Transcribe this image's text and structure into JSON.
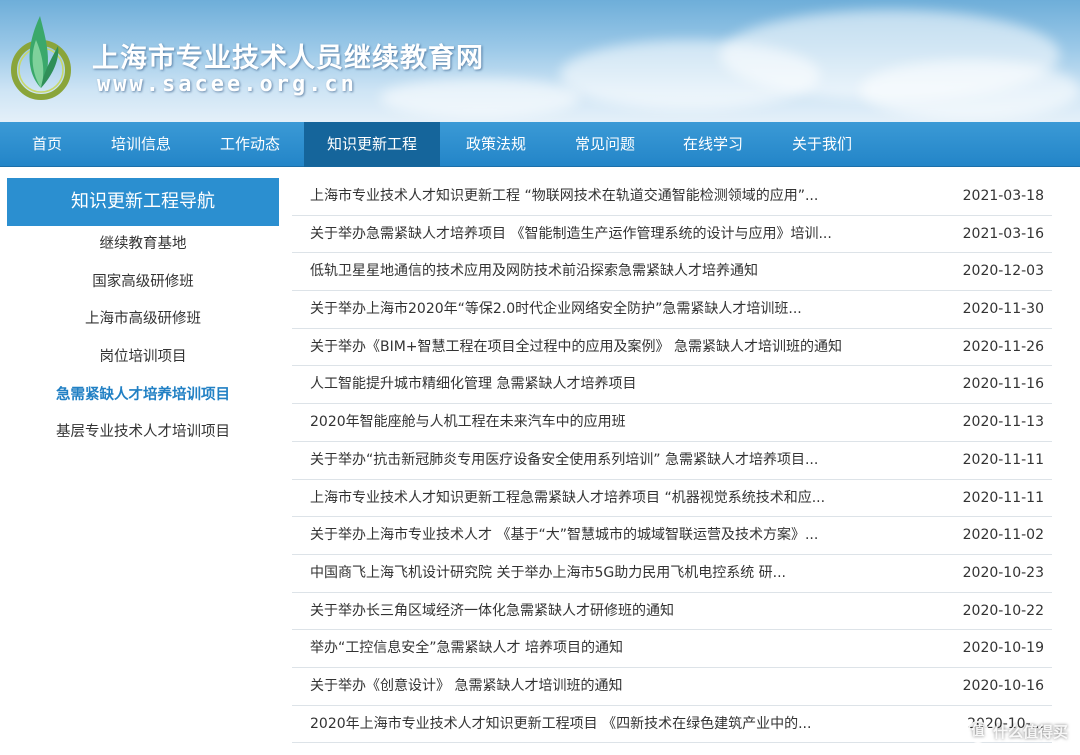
{
  "header": {
    "site_title": "上海市专业技术人员继续教育网",
    "site_url": "www.sacee.org.cn"
  },
  "nav": {
    "items": [
      {
        "label": "首页"
      },
      {
        "label": "培训信息"
      },
      {
        "label": "工作动态"
      },
      {
        "label": "知识更新工程",
        "active": true
      },
      {
        "label": "政策法规"
      },
      {
        "label": "常见问题"
      },
      {
        "label": "在线学习"
      },
      {
        "label": "关于我们"
      }
    ]
  },
  "sidebar": {
    "title": "知识更新工程导航",
    "items": [
      {
        "label": "继续教育基地"
      },
      {
        "label": "国家高级研修班"
      },
      {
        "label": "上海市高级研修班"
      },
      {
        "label": "岗位培训项目"
      },
      {
        "label": "急需紧缺人才培养培训项目",
        "active": true
      },
      {
        "label": "基层专业技术人才培训项目"
      }
    ]
  },
  "news": [
    {
      "title": "上海市专业技术人才知识更新工程 “物联网技术在轨道交通智能检测领域的应用”...",
      "date": "2021-03-18"
    },
    {
      "title": "关于举办急需紧缺人才培养项目 《智能制造生产运作管理系统的设计与应用》培训...",
      "date": "2021-03-16"
    },
    {
      "title": "低轨卫星星地通信的技术应用及网防技术前沿探索急需紧缺人才培养通知",
      "date": "2020-12-03"
    },
    {
      "title": "关于举办上海市2020年“等保2.0时代企业网络安全防护”急需紧缺人才培训班...",
      "date": "2020-11-30"
    },
    {
      "title": "关于举办《BIM+智慧工程在项目全过程中的应用及案例》 急需紧缺人才培训班的通知",
      "date": "2020-11-26"
    },
    {
      "title": "人工智能提升城市精细化管理 急需紧缺人才培养项目",
      "date": "2020-11-16"
    },
    {
      "title": "2020年智能座舱与人机工程在未来汽车中的应用班",
      "date": "2020-11-13"
    },
    {
      "title": "关于举办“抗击新冠肺炎专用医疗设备安全使用系列培训” 急需紧缺人才培养项目...",
      "date": "2020-11-11"
    },
    {
      "title": "上海市专业技术人才知识更新工程急需紧缺人才培养项目 “机器视觉系统技术和应...",
      "date": "2020-11-11"
    },
    {
      "title": "关于举办上海市专业技术人才 《基于“大”智慧城市的城域智联运营及技术方案》...",
      "date": "2020-11-02"
    },
    {
      "title": "中国商飞上海飞机设计研究院 关于举办上海市5G助力民用飞机电控系统 研...",
      "date": "2020-10-23"
    },
    {
      "title": "关于举办长三角区域经济一体化急需紧缺人才研修班的通知",
      "date": "2020-10-22"
    },
    {
      "title": "举办“工控信息安全”急需紧缺人才 培养项目的通知",
      "date": "2020-10-19"
    },
    {
      "title": "关于举办《创意设计》 急需紧缺人才培训班的通知",
      "date": "2020-10-16"
    },
    {
      "title": "2020年上海市专业技术人才知识更新工程项目 《四新技术在绿色建筑产业中的...",
      "date": "2020-10-..."
    }
  ],
  "watermark": {
    "text": "什么值得买",
    "badge": "值"
  },
  "colors": {
    "nav_bg": "#2385c8",
    "nav_active": "#15659b",
    "sidebar_head": "#2b8fd0",
    "sidebar_active": "#2180c4"
  },
  "icons": {
    "logo": "leaf-emblem-icon"
  }
}
